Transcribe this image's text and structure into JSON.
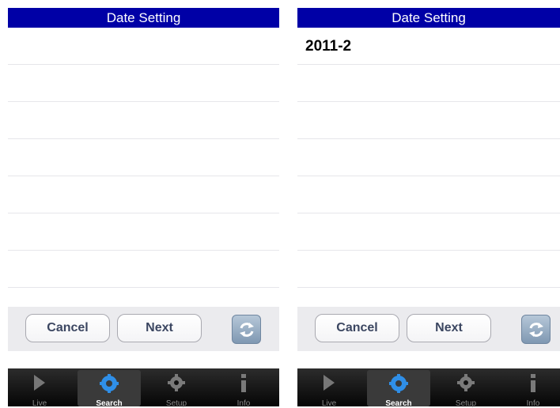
{
  "screens": [
    {
      "title": "Date Setting",
      "rows": [
        "",
        "",
        "",
        "",
        "",
        "",
        "",
        ""
      ],
      "toolbar": {
        "cancel_label": "Cancel",
        "next_label": "Next"
      },
      "tabs": [
        {
          "label": "Live",
          "icon": "play-icon"
        },
        {
          "label": "Search",
          "icon": "search-gear-icon",
          "active": true
        },
        {
          "label": "Setup",
          "icon": "gear-icon"
        },
        {
          "label": "Info",
          "icon": "info-icon"
        }
      ]
    },
    {
      "title": "Date Setting",
      "rows": [
        "2011-2",
        "",
        "",
        "",
        "",
        "",
        "",
        ""
      ],
      "toolbar": {
        "cancel_label": "Cancel",
        "next_label": "Next"
      },
      "tabs": [
        {
          "label": "Live",
          "icon": "play-icon"
        },
        {
          "label": "Search",
          "icon": "search-gear-icon",
          "active": true
        },
        {
          "label": "Setup",
          "icon": "gear-icon"
        },
        {
          "label": "Info",
          "icon": "info-icon"
        }
      ]
    }
  ],
  "colors": {
    "title_bar": "#0000a6",
    "button_text": "#3b4661",
    "tab_bar": "#050505"
  }
}
